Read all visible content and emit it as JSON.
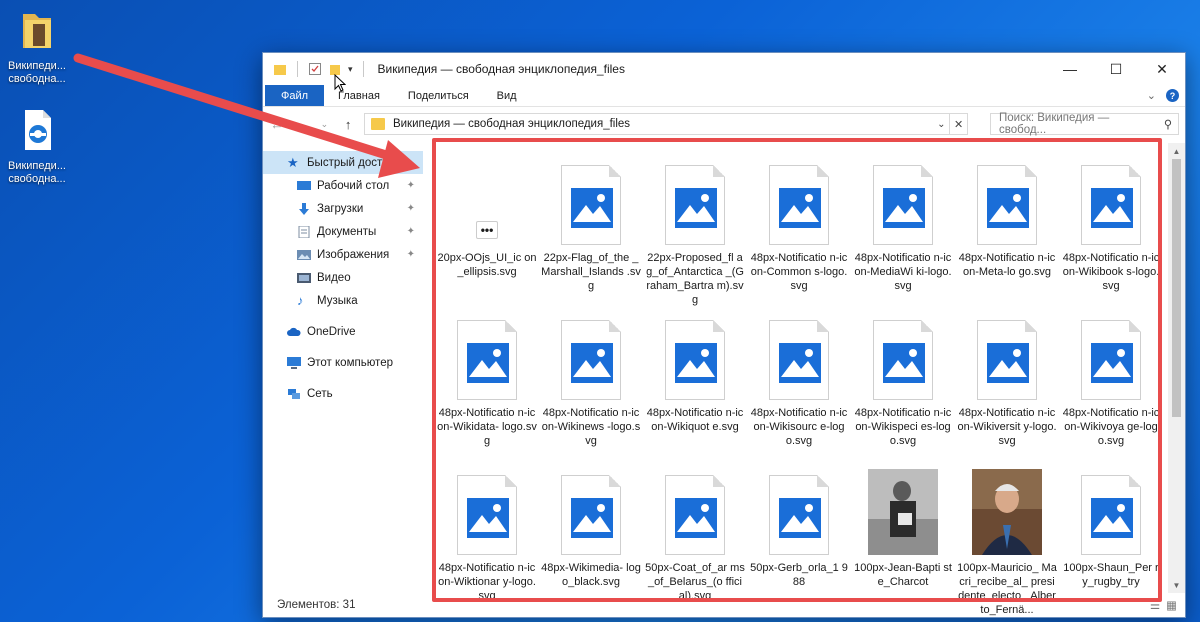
{
  "desktop": {
    "folder_label": "Википеди... свободна...",
    "edge_label": "Википеди... свободна..."
  },
  "window": {
    "title": "Википедия — свободная энциклопедия_files",
    "controls": {
      "minimize": "—",
      "maximize": "☐",
      "close": "✕"
    }
  },
  "ribbon": {
    "tabs": [
      "Файл",
      "Главная",
      "Поделиться",
      "Вид"
    ]
  },
  "address": {
    "path": "Википедия — свободная энциклопедия_files",
    "search_placeholder": "Поиск: Википедия — свобод..."
  },
  "nav": {
    "items": [
      {
        "label": "Быстрый доступ"
      },
      {
        "label": "Рабочий стол"
      },
      {
        "label": "Загрузки"
      },
      {
        "label": "Документы"
      },
      {
        "label": "Изображения"
      },
      {
        "label": "Видео"
      },
      {
        "label": "Музыка"
      },
      {
        "label": "OneDrive"
      },
      {
        "label": "Этот компьютер"
      },
      {
        "label": "Сеть"
      }
    ]
  },
  "files": [
    {
      "name": "20px-OOjs_UI_ic on_ellipsis.svg"
    },
    {
      "name": "22px-Flag_of_the _Marshall_Islands .svg"
    },
    {
      "name": "22px-Proposed_fl ag_of_Antarctica _(Graham_Bartra m).svg"
    },
    {
      "name": "48px-Notificatio n-icon-Common s-logo.svg"
    },
    {
      "name": "48px-Notificatio n-icon-MediaWi ki-logo.svg"
    },
    {
      "name": "48px-Notificatio n-icon-Meta-lo go.svg"
    },
    {
      "name": "48px-Notificatio n-icon-Wikibook s-logo.svg"
    },
    {
      "name": "48px-Notificatio n-icon-Wikidata- logo.svg"
    },
    {
      "name": "48px-Notificatio n-icon-Wikinews -logo.svg"
    },
    {
      "name": "48px-Notificatio n-icon-Wikiquot e.svg"
    },
    {
      "name": "48px-Notificatio n-icon-Wikisourc e-logo.svg"
    },
    {
      "name": "48px-Notificatio n-icon-Wikispeci es-logo.svg"
    },
    {
      "name": "48px-Notificatio n-icon-Wikiversit y-logo.svg"
    },
    {
      "name": "48px-Notificatio n-icon-Wikivoya ge-logo.svg"
    },
    {
      "name": "48px-Notificatio n-icon-Wiktionar y-logo.svg"
    },
    {
      "name": "48px-Wikimedia- logo_black.svg"
    },
    {
      "name": "50px-Coat_of_ar ms_of_Belarus_(o fficial).svg"
    },
    {
      "name": "50px-Gerb_orla_1 988"
    },
    {
      "name": "100px-Jean-Bapti ste_Charcot"
    },
    {
      "name": "100px-Mauricio_ Macri_recibe_al_ presidente_electo _Alberto_Fernä..."
    },
    {
      "name": "100px-Shaun_Per ry_rugby_try"
    }
  ],
  "status": {
    "items_count": "Элементов: 31"
  },
  "colors": {
    "accent_blue": "#1a64c3",
    "highlight_red": "#e84c4c",
    "folder_yellow": "#f6c94a"
  }
}
